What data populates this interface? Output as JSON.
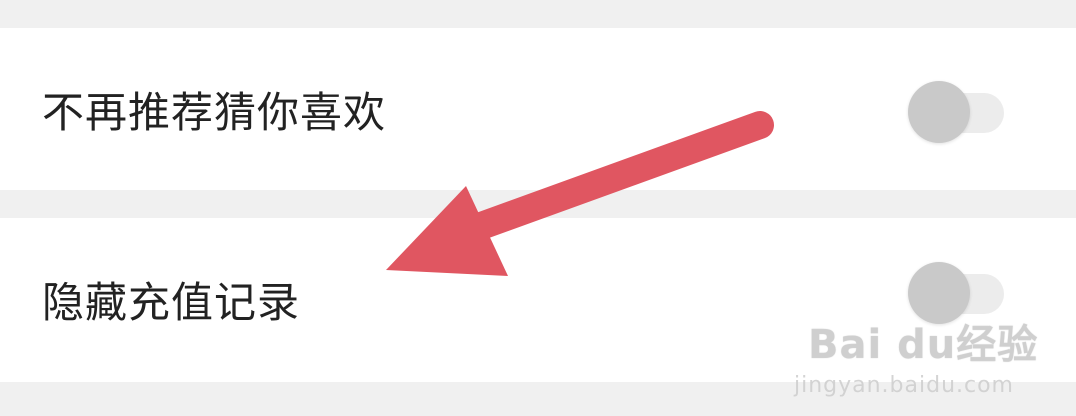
{
  "settings": {
    "items": [
      {
        "label": "不再推荐猜你喜欢",
        "enabled": false
      },
      {
        "label": "隐藏充值记录",
        "enabled": false
      }
    ]
  },
  "annotation": {
    "arrow_color": "#e05661"
  },
  "watermark": {
    "logo_text": "Bai du经验",
    "url": "jingyan.baidu.com"
  },
  "colors": {
    "background": "#f0f0f0",
    "row": "#ffffff",
    "text": "#222222",
    "toggle_knob_off": "#c9c9c9",
    "toggle_track_off": "#ececec"
  }
}
